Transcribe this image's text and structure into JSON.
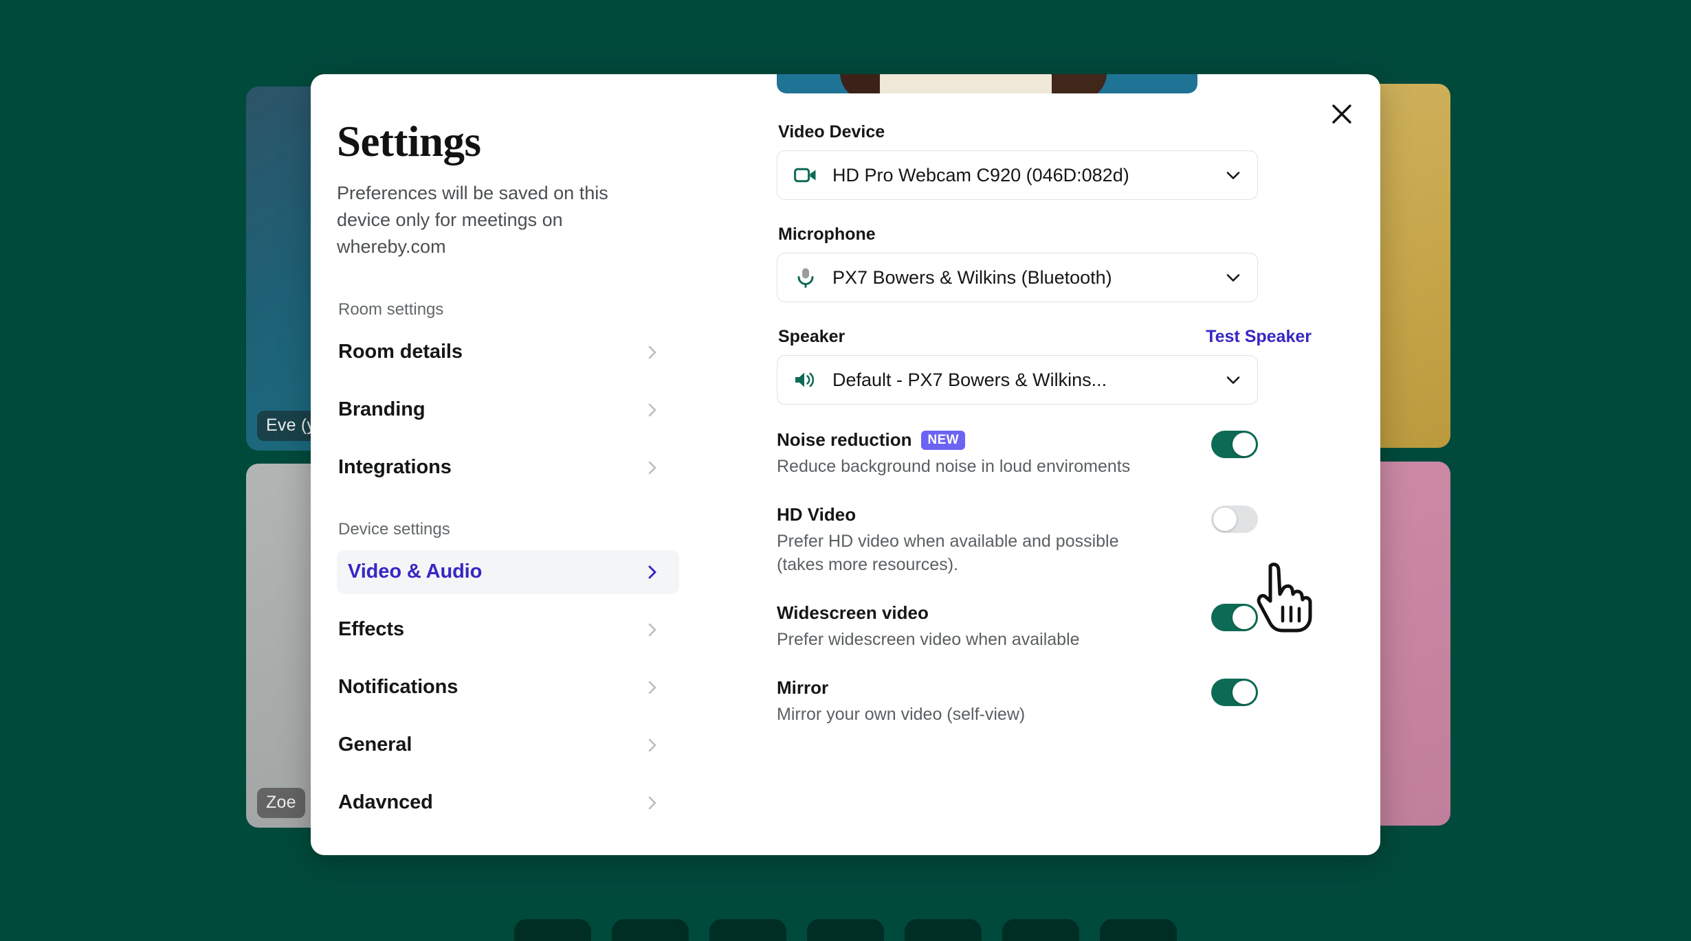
{
  "background": {
    "color": "#004A3C",
    "tiles": [
      {
        "name": "eve",
        "label": "Eve (y",
        "color": "#1e6176"
      },
      {
        "name": "zoe",
        "label": "Zoe",
        "color": "#a9acab"
      },
      {
        "name": "gold",
        "label": "",
        "color": "#c6a549"
      },
      {
        "name": "pink",
        "label": "",
        "color": "#c784a1"
      }
    ],
    "toolbar_button_count": 7
  },
  "modal": {
    "close_label": "Close",
    "title": "Settings",
    "subtitle": "Preferences will be saved on this device only for meetings on whereby.com",
    "accent_color": "#3626C4",
    "toggle_on_color": "#0D6B55",
    "badge_color": "#6C63F2"
  },
  "sidebar": {
    "groups": [
      {
        "label": "Room settings",
        "items": [
          {
            "label": "Room details",
            "active": false
          },
          {
            "label": "Branding",
            "active": false
          },
          {
            "label": "Integrations",
            "active": false
          }
        ]
      },
      {
        "label": "Device settings",
        "items": [
          {
            "label": "Video & Audio",
            "active": true
          },
          {
            "label": "Effects",
            "active": false
          },
          {
            "label": "Notifications",
            "active": false
          },
          {
            "label": "General",
            "active": false
          },
          {
            "label": "Adavnced",
            "active": false
          }
        ]
      }
    ]
  },
  "panel": {
    "video_device": {
      "label": "Video Device",
      "value": "HD Pro Webcam C920 (046D:082d)",
      "icon": "video-camera-icon"
    },
    "microphone": {
      "label": "Microphone",
      "value": "PX7 Bowers & Wilkins (Bluetooth)",
      "icon": "microphone-icon"
    },
    "speaker": {
      "label": "Speaker",
      "action_label": "Test Speaker",
      "value": "Default - PX7 Bowers & Wilkins...",
      "icon": "speaker-icon"
    },
    "toggles": [
      {
        "title": "Noise reduction",
        "badge": "NEW",
        "description": "Reduce background noise in loud enviroments",
        "state": "on"
      },
      {
        "title": "HD Video",
        "badge": "",
        "description": "Prefer HD video when available and possible (takes more resources).",
        "state": "off"
      },
      {
        "title": "Widescreen video",
        "badge": "",
        "description": "Prefer widescreen video when available",
        "state": "on"
      },
      {
        "title": "Mirror",
        "badge": "",
        "description": "Mirror your own video (self-view)",
        "state": "on"
      }
    ]
  }
}
